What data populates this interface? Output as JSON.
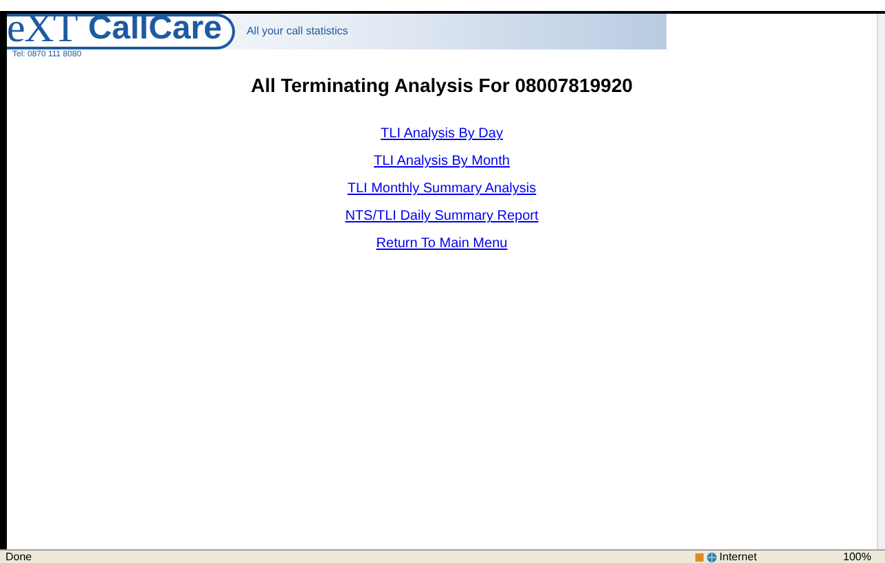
{
  "header": {
    "logo_text": "eXT",
    "brand": "CallCare",
    "tagline": "All your call statistics",
    "phone": "Tel: 0870 111 8080"
  },
  "title": "All Terminating Analysis For 08007819920",
  "links": [
    "TLI Analysis By Day",
    "TLI Analysis By Month",
    "TLI Monthly Summary Analysis",
    "NTS/TLI Daily Summary Report",
    "Return To Main Menu"
  ],
  "status_bar": {
    "status": "Done",
    "zone": "Internet",
    "zoom": "100%"
  }
}
